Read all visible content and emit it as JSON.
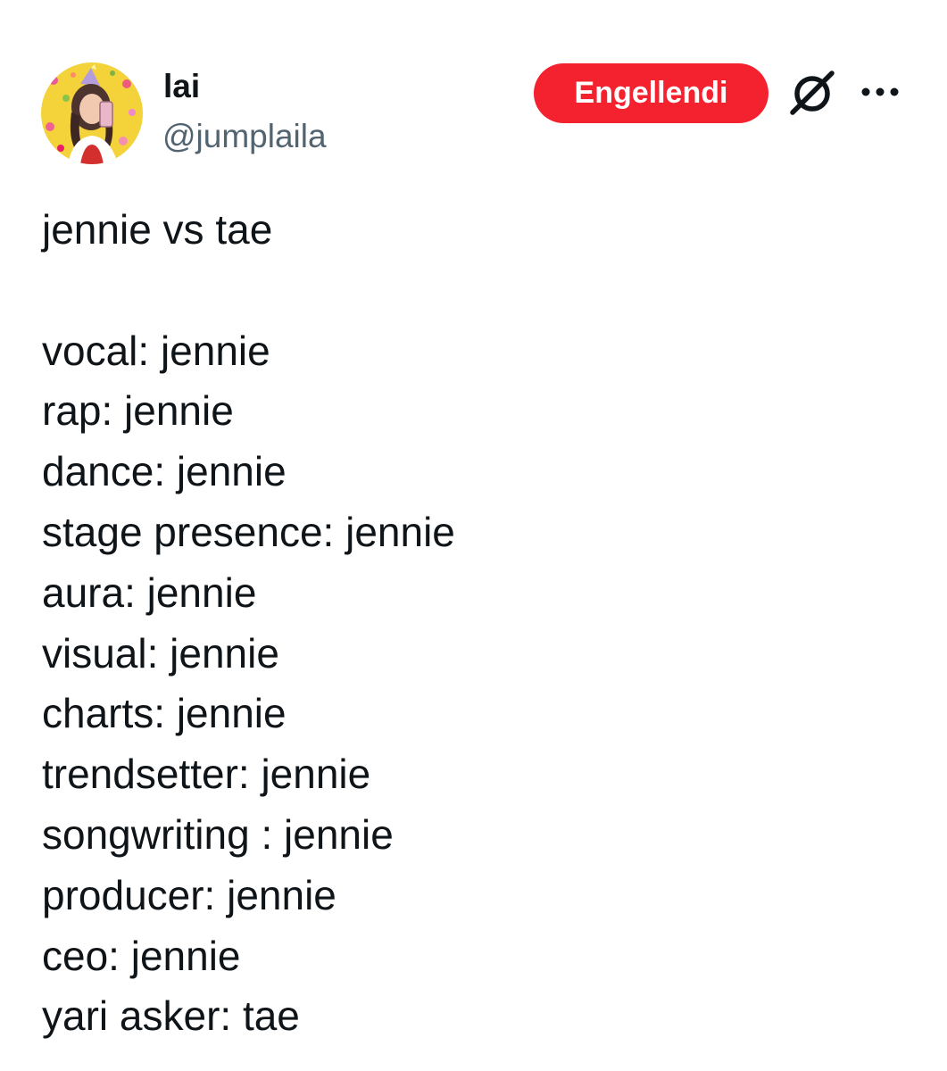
{
  "author": {
    "display_name": "lai",
    "handle": "@jumplaila",
    "avatar_icon": "profile-photo-avatar"
  },
  "actions": {
    "block_button_label": "Engellendi",
    "block_button_color": "#f4212e",
    "grok_icon": "slashed-circle-icon",
    "more_icon": "more-horizontal-icon"
  },
  "tweet": {
    "title_line": "jennie vs tae",
    "lines": [
      "vocal: jennie",
      "rap: jennie",
      "dance: jennie",
      "stage presence: jennie",
      "aura: jennie",
      "visual: jennie",
      "charts: jennie",
      "trendsetter: jennie",
      "songwriting : jennie",
      "producer: jennie",
      "ceo: jennie",
      "yari asker: tae"
    ]
  }
}
